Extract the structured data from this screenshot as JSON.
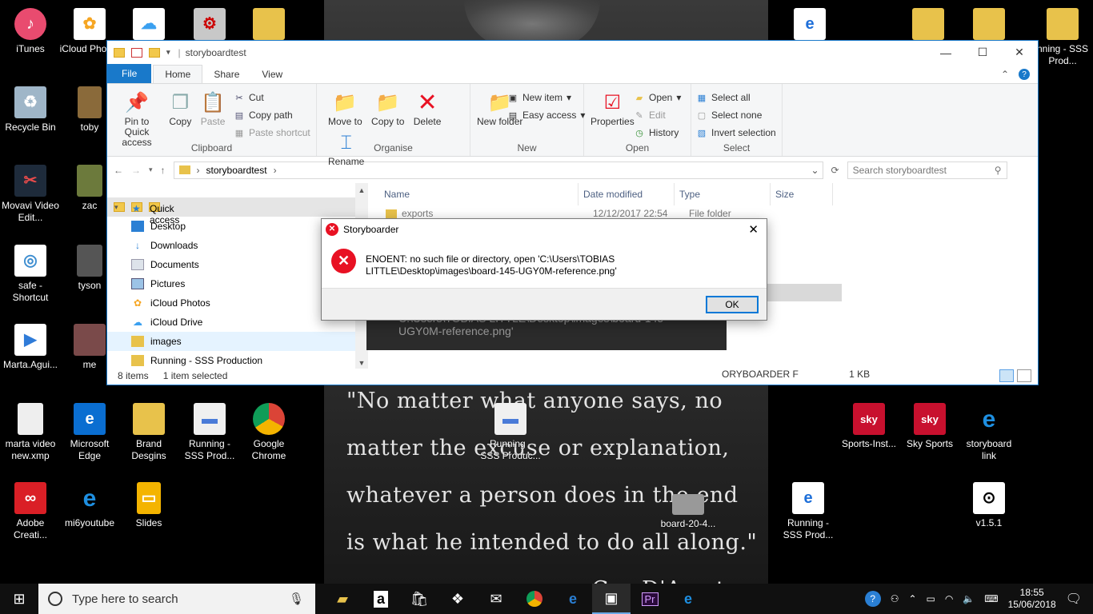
{
  "wallpaper": {
    "quote_lines": [
      "\"No matter what anyone says, no",
      "matter the excuse or explanation,",
      "whatever a person does in the end",
      "is what he intended to do all along.\"",
      "- Cus D'Amato"
    ]
  },
  "desktop_icons": [
    {
      "label": "iTunes",
      "icon": "itunes-icon",
      "color": "#e94b6f"
    },
    {
      "label": "iCloud Photos",
      "icon": "icloud-photos-icon",
      "color": "#f6a623"
    },
    {
      "label": "Recycle Bin",
      "icon": "recycle-bin-icon",
      "color": "#9fb6c8"
    },
    {
      "label": "toby",
      "icon": "photo-icon",
      "color": "#8a6a3a"
    },
    {
      "label": "Movavi Video Edit...",
      "icon": "movavi-icon",
      "color": "#c23b3b"
    },
    {
      "label": "zac",
      "icon": "photo-icon",
      "color": "#6c7a3c"
    },
    {
      "label": "safe - Shortcut",
      "icon": "shortcut-icon",
      "color": "#3e8ed0"
    },
    {
      "label": "tyson",
      "icon": "photo-icon",
      "color": "#555555"
    },
    {
      "label": "Marta.Agui...",
      "icon": "video-file-icon",
      "color": "#2f7bd8"
    },
    {
      "label": "me",
      "icon": "photo-icon",
      "color": "#7a4a4a"
    },
    {
      "label": "marta video new.xmp",
      "icon": "file-icon",
      "color": "#eeeeee"
    },
    {
      "label": "Microsoft Edge",
      "icon": "edge-icon",
      "color": "#0a6ed1"
    },
    {
      "label": "Brand Desgins",
      "icon": "folder-icon",
      "color": "#e8c24b"
    },
    {
      "label": "Running - SSS Prod...",
      "icon": "doc-icon",
      "color": "#f0f0f0"
    },
    {
      "label": "Google Chrome",
      "icon": "chrome-icon",
      "color": "#db4437"
    },
    {
      "label": "Adobe Creati...",
      "icon": "adobe-cc-icon",
      "color": "#da1f26"
    },
    {
      "label": "mi6youtube",
      "icon": "ie-icon",
      "color": "#1e8fe1"
    },
    {
      "label": "Slides",
      "icon": "slides-icon",
      "color": "#f4b400"
    },
    {
      "label": "Running - SSS Produc...",
      "icon": "doc-icon",
      "color": "#f0f0f0"
    },
    {
      "label": "board-20-4...",
      "icon": "image-icon",
      "color": "#999999"
    },
    {
      "label": "Running - SSS Prod...",
      "icon": "pdf-icon",
      "color": "#1e6fd9"
    },
    {
      "label": "Sports-Inst...",
      "icon": "sky-sports-icon",
      "color": "#c8102e"
    },
    {
      "label": "Sky Sports",
      "icon": "sky-sports-icon",
      "color": "#c8102e"
    },
    {
      "label": "storyboard link",
      "icon": "ie-icon",
      "color": "#1e8fe1"
    },
    {
      "label": "v1.5.1",
      "icon": "github-icon",
      "color": "#ffffff"
    },
    {
      "label": "nning - SSS Prod...",
      "icon": "zip-folder-icon",
      "color": "#e8c24b"
    }
  ],
  "explorer": {
    "title": "storyboardtest",
    "tabs": [
      "File",
      "Home",
      "Share",
      "View"
    ],
    "ribbon": {
      "clipboard": {
        "name": "Clipboard",
        "pin": "Pin to Quick access",
        "copy": "Copy",
        "paste": "Paste",
        "cut": "Cut",
        "copy_path": "Copy path",
        "paste_shortcut": "Paste shortcut"
      },
      "organise": {
        "name": "Organise",
        "move_to": "Move to",
        "copy_to": "Copy to",
        "delete": "Delete",
        "rename": "Rename"
      },
      "new": {
        "name": "New",
        "new_folder": "New folder",
        "new_item": "New item",
        "easy_access": "Easy access"
      },
      "open": {
        "name": "Open",
        "properties": "Properties",
        "open": "Open",
        "edit": "Edit",
        "history": "History"
      },
      "select": {
        "name": "Select",
        "select_all": "Select all",
        "select_none": "Select none",
        "invert": "Invert selection"
      }
    },
    "address": {
      "path": "storyboardtest",
      "search_placeholder": "Search storyboardtest"
    },
    "nav": [
      {
        "label": "Quick access",
        "icon": "star-icon"
      },
      {
        "label": "Desktop",
        "icon": "desktop-icon"
      },
      {
        "label": "Downloads",
        "icon": "downloads-icon"
      },
      {
        "label": "Documents",
        "icon": "documents-icon"
      },
      {
        "label": "Pictures",
        "icon": "pictures-icon"
      },
      {
        "label": "iCloud Photos",
        "icon": "icloud-photos-icon"
      },
      {
        "label": "iCloud Drive",
        "icon": "icloud-drive-icon"
      },
      {
        "label": "images",
        "icon": "folder-icon"
      },
      {
        "label": "Running - SSS Production",
        "icon": "folder-icon"
      }
    ],
    "columns": [
      "Name",
      "Date modified",
      "Type",
      "Size"
    ],
    "rows": [
      {
        "name": "exports",
        "date": "12/12/2017 22:54",
        "type": "File folder",
        "size": ""
      },
      {
        "name": "",
        "date": "",
        "type": "ORYBOARDER F",
        "size": "1 KB"
      }
    ],
    "status": {
      "items": "8 items",
      "selected": "1 item selected"
    }
  },
  "tooltip_text": "C:\\Users\\TOBIAS LITTLE\\Desktop\\images\\board-145-UGY0M-reference.png'",
  "dialog": {
    "title": "Storyboarder",
    "message_line1": "ENOENT: no such file or directory, open 'C:\\Users\\TOBIAS",
    "message_line2": "LITTLE\\Desktop\\images\\board-145-UGY0M-reference.png'",
    "ok": "OK"
  },
  "taskbar": {
    "search_placeholder": "Type here to search",
    "time": "18:55",
    "date": "15/06/2018"
  }
}
